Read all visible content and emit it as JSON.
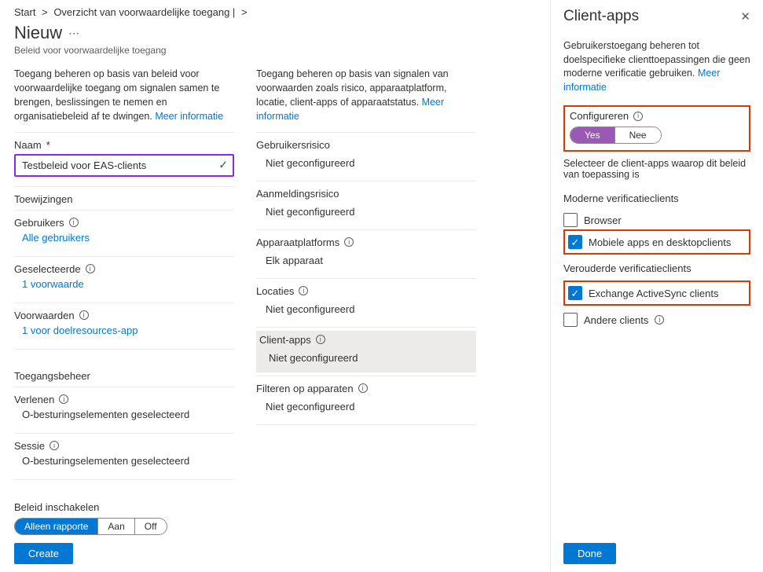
{
  "breadcrumb": {
    "home": "Start",
    "sep": ">",
    "overview": "Overzicht van voorwaardelijke toegang |",
    "trail_sep": ">"
  },
  "page": {
    "title": "Nieuw",
    "subtitle": "Beleid voor voorwaardelijke toegang"
  },
  "left": {
    "desc": "Toegang beheren op basis van beleid voor voorwaardelijke toegang om signalen samen te brengen, beslissingen te nemen en organisatiebeleid af te dwingen.",
    "more_info": "Meer informatie",
    "name_label": "Naam",
    "name_value": "Testbeleid voor EAS-clients",
    "assignments_heading": "Toewijzingen",
    "users": {
      "label": "Gebruikers",
      "value": "Alle gebruikers"
    },
    "selected": {
      "label": "Geselecteerde",
      "value": "1 voorwaarde"
    },
    "conditions": {
      "label": "Voorwaarden",
      "value": "1 voor doelresources-app"
    },
    "access_heading": "Toegangsbeheer",
    "grant": {
      "label": "Verlenen",
      "value": "O-besturingselementen geselecteerd"
    },
    "session": {
      "label": "Sessie",
      "value": "O-besturingselementen geselecteerd"
    }
  },
  "right_col": {
    "desc": "Toegang beheren op basis van signalen van voorwaarden zoals risico, apparaatplatform, locatie, client-apps of apparaatstatus.",
    "more_info": "Meer informatie",
    "items": [
      {
        "label": "Gebruikersrisico",
        "value": "Niet geconfigureerd",
        "selected": false
      },
      {
        "label": "Aanmeldingsrisico",
        "value": "Niet geconfigureerd",
        "selected": false
      },
      {
        "label": "Apparaatplatforms",
        "value": "Elk apparaat",
        "selected": false,
        "info": true
      },
      {
        "label": "Locaties",
        "value": "Niet geconfigureerd",
        "selected": false,
        "info": true
      },
      {
        "label": "Client-apps",
        "value": "Niet geconfigureerd",
        "selected": true,
        "info": true
      },
      {
        "label": "Filteren op apparaten",
        "value": "Niet geconfigureerd",
        "selected": false,
        "info": true
      }
    ]
  },
  "footer": {
    "enable_label": "Beleid inschakelen",
    "options": {
      "report": "Alleen rapporte",
      "on": "Aan",
      "off": "Off"
    },
    "create": "Create"
  },
  "panel": {
    "title": "Client-apps",
    "desc": "Gebruikerstoegang beheren tot doelspecifieke clienttoepassingen die geen moderne verificatie gebruiken.",
    "more_info": "Meer informatie",
    "configure_label": "Configureren",
    "toggle": {
      "yes": "Yes",
      "no": "Nee"
    },
    "select_text": "Selecteer de client-apps waarop dit beleid van toepassing is",
    "group_modern": "Moderne verificatieclients",
    "cb_browser": "Browser",
    "cb_mobile": "Mobiele apps en desktopclients",
    "group_legacy": "Verouderde verificatieclients",
    "cb_eas": "Exchange ActiveSync clients",
    "cb_other": "Andere clients",
    "done": "Done"
  }
}
